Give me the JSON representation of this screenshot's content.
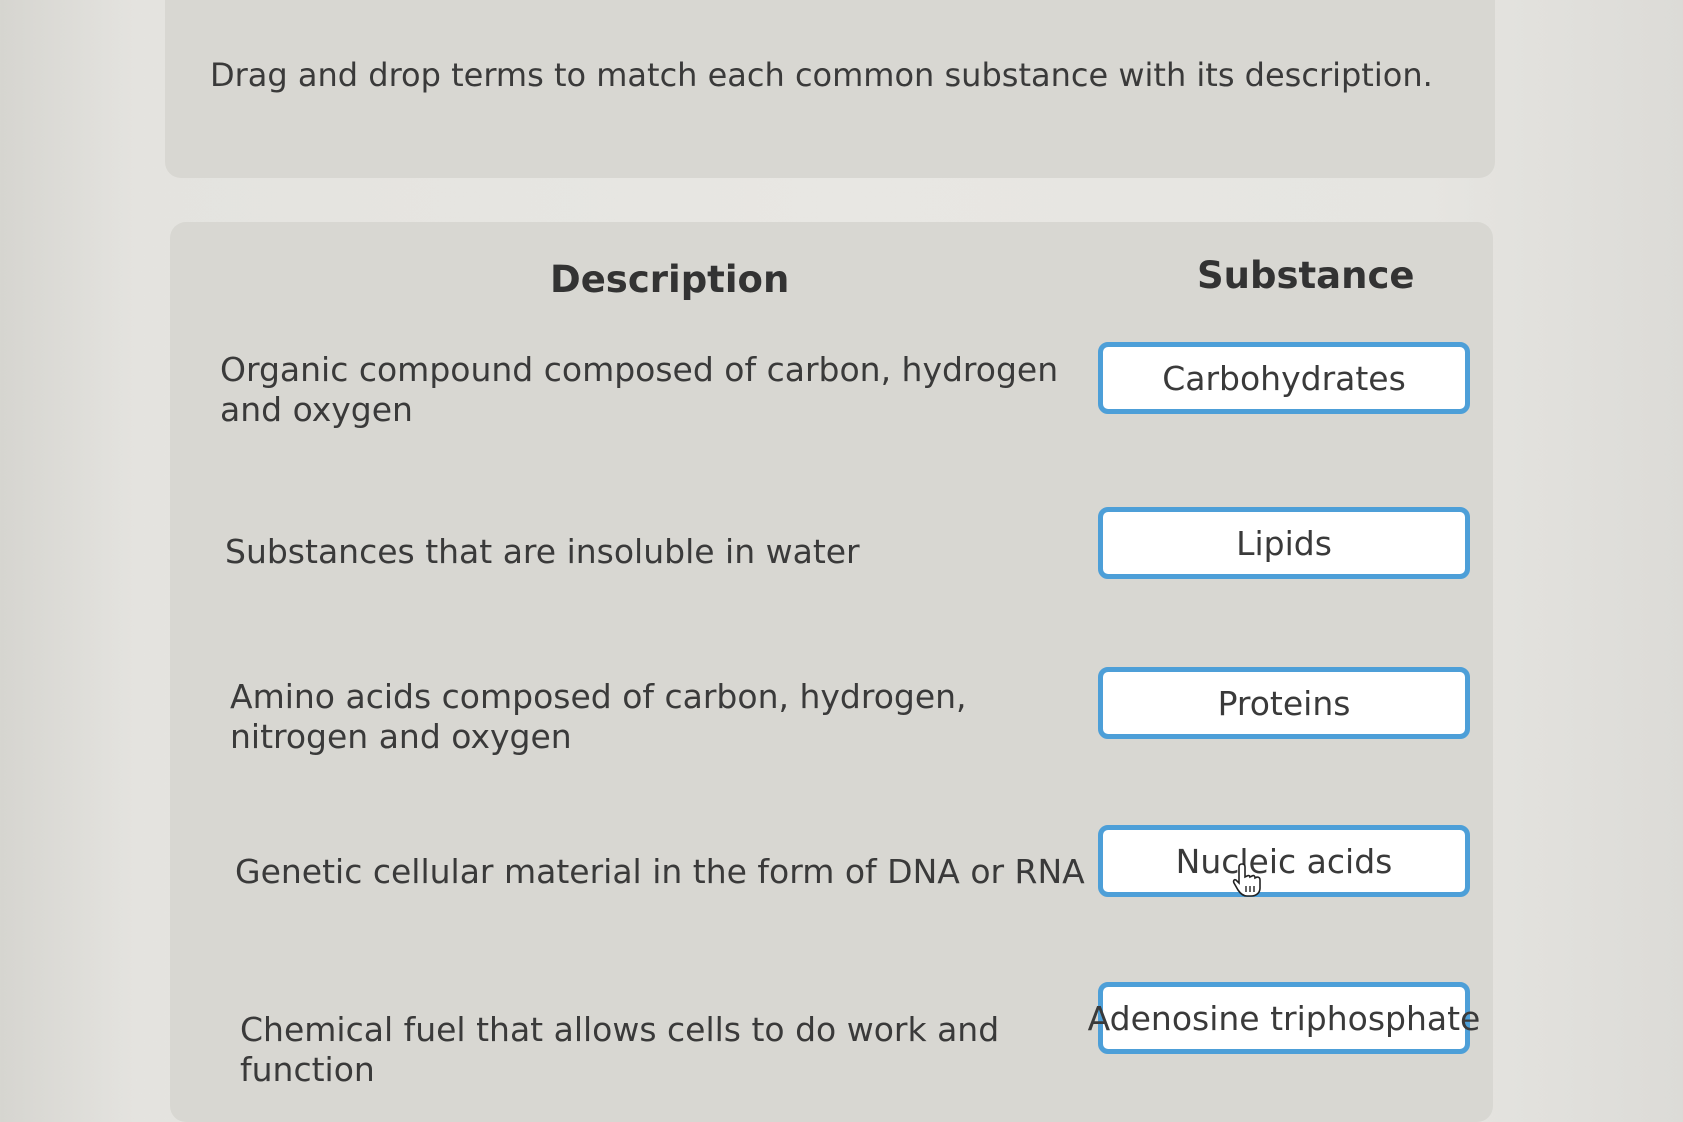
{
  "prompt": {
    "text": "Drag and drop terms to match each common substance with its description."
  },
  "table": {
    "description_header": "Description",
    "substance_header": "Substance",
    "rows": [
      {
        "description": "Organic compound composed of carbon, hydrogen and oxygen",
        "term": "Carbohydrates"
      },
      {
        "description": "Substances that are insoluble in water",
        "term": "Lipids"
      },
      {
        "description": "Amino acids composed of carbon, hydrogen, nitrogen and oxygen",
        "term": "Proteins"
      },
      {
        "description": "Genetic cellular material in the form of DNA or RNA",
        "term": "Nucleic acids"
      },
      {
        "description": "Chemical fuel that allows cells to do work and function",
        "term": "Adenosine triphosphate"
      }
    ]
  },
  "colors": {
    "term_border": "#4d9fd8",
    "card_background": "#d8d7d2"
  },
  "icons": {
    "cursor": "hand-pointer-icon"
  }
}
